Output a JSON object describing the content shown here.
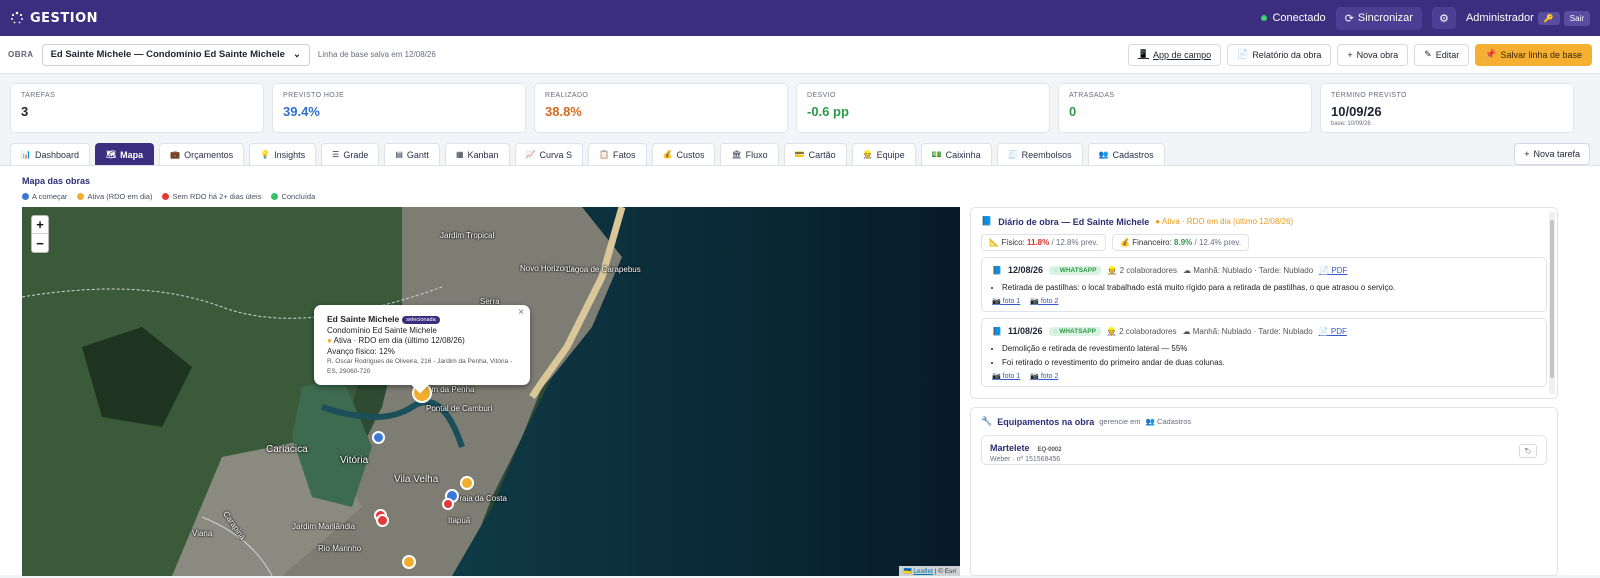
{
  "topbar": {
    "logo": "GESTION",
    "logo_sub": "",
    "status": "Conectado",
    "sync": "Sincronizar",
    "user": "Administrador",
    "key_icon": "key-icon",
    "logout": "Sair"
  },
  "obra_bar": {
    "label": "OBRA",
    "selected": "Ed Sainte Michele — Condomínio Ed Sainte Michele",
    "base_note": "Linha de base salva em 12/08/26",
    "actions": {
      "app": "App de campo",
      "report": "Relatório da obra",
      "new": "Nova obra",
      "edit": "Editar",
      "save_base": "Salvar linha de base"
    }
  },
  "kpis": [
    {
      "label": "TAREFAS",
      "value": "3",
      "color": "#1f2233"
    },
    {
      "label": "PREVISTO HOJE",
      "value": "39.4%",
      "color": "#2f6fd0"
    },
    {
      "label": "REALIZADO",
      "value": "38.8%",
      "color": "#d06a1c"
    },
    {
      "label": "DESVIO",
      "value": "-0.6 pp",
      "color": "#2e9a48"
    },
    {
      "label": "ATRASADAS",
      "value": "0",
      "color": "#2e9a48"
    },
    {
      "label": "TÉRMINO PREVISTO",
      "value": "10/09/26",
      "sub": "base: 10/09/26",
      "color": "#1f2233"
    }
  ],
  "tabs": [
    "Dashboard",
    "Mapa",
    "Orçamentos",
    "Insights",
    "Grade",
    "Gantt",
    "Kanban",
    "Curva S",
    "Fatos",
    "Custos",
    "Fluxo",
    "Cartão",
    "Equipe",
    "Caixinha",
    "Reembolsos",
    "Cadastros"
  ],
  "tab_icons": [
    "📊",
    "🗺",
    "💼",
    "💡",
    "☰",
    "▤",
    "▦",
    "📈",
    "📋",
    "💰",
    "🏛",
    "💳",
    "👷",
    "💵",
    "🧾",
    "👥"
  ],
  "new_task": "Nova tarefa",
  "map": {
    "title": "Mapa das obras",
    "legend": [
      {
        "label": "A começar",
        "color": "#3a78d4"
      },
      {
        "label": "Ativa (RDO em dia)",
        "color": "#f0ad2e"
      },
      {
        "label": "Sem RDO há 2+ dias úteis",
        "color": "#e03a3a"
      },
      {
        "label": "Concluída",
        "color": "#37c26c"
      }
    ],
    "places": [
      "Jardim Tropical",
      "Novo Horizonte",
      "Lagoa de Carapebus",
      "Serra",
      "Jardim da Penha",
      "Pontal de Camburi",
      "Cariacica",
      "Vitória",
      "Vila Velha",
      "Praia da Costa",
      "Itapuã",
      "Jardim Marilândia",
      "Rio Marinho",
      "Viana",
      "Carapina"
    ],
    "popup": {
      "name": "Ed Sainte Michele",
      "badge": "selecionada",
      "full": "Condomínio Ed Sainte Michele",
      "status": "Ativa · RDO em dia (último 12/08/26)",
      "progress": "Avanço físico: 12%",
      "address": "R. Oscar Rodrigues de Oliveira, 216 - Jardim da Penha, Vitória - ES, 29060-720"
    },
    "attribution_leaflet": "Leaflet",
    "attribution_rest": "| © Esri"
  },
  "diary": {
    "title": "Diário de obra — Ed Sainte Michele",
    "status": "Ativa · RDO em dia (último 12/08/26)",
    "fisico": {
      "label": "Físico:",
      "value": "11.8%",
      "prev": "/ 12.8% prev."
    },
    "financeiro": {
      "label": "Financeiro:",
      "value": "8.9%",
      "prev": "/ 12.4% prev."
    },
    "entries": [
      {
        "date": "12/08/26",
        "source": "WHATSAPP",
        "people": "2 colaboradores",
        "weather": "Manhã: Nublado · Tarde: Nublado",
        "pdf": "PDF",
        "items": [
          "Retirada de pastilhas: o local trabalhado está muito rígido para a retirada de pastilhas, o que atrasou o serviço."
        ],
        "photos": [
          "foto 1",
          "foto 2"
        ]
      },
      {
        "date": "11/08/26",
        "source": "WHATSAPP",
        "people": "2 colaboradores",
        "weather": "Manhã: Nublado · Tarde: Nublado",
        "pdf": "PDF",
        "items": [
          "Demolição e retirada de revestimento lateral — 55%",
          "Foi retirado o revestimento do primeiro andar de duas colunas."
        ],
        "photos": [
          "foto 1",
          "foto 2"
        ]
      }
    ]
  },
  "equipment": {
    "title": "Equipamentos na obra",
    "note": "gerencie em",
    "link": "Cadastros",
    "items": [
      {
        "name": "Martelete",
        "code": "EQ-0002",
        "sub": "Weber · nº 151568456"
      }
    ]
  }
}
